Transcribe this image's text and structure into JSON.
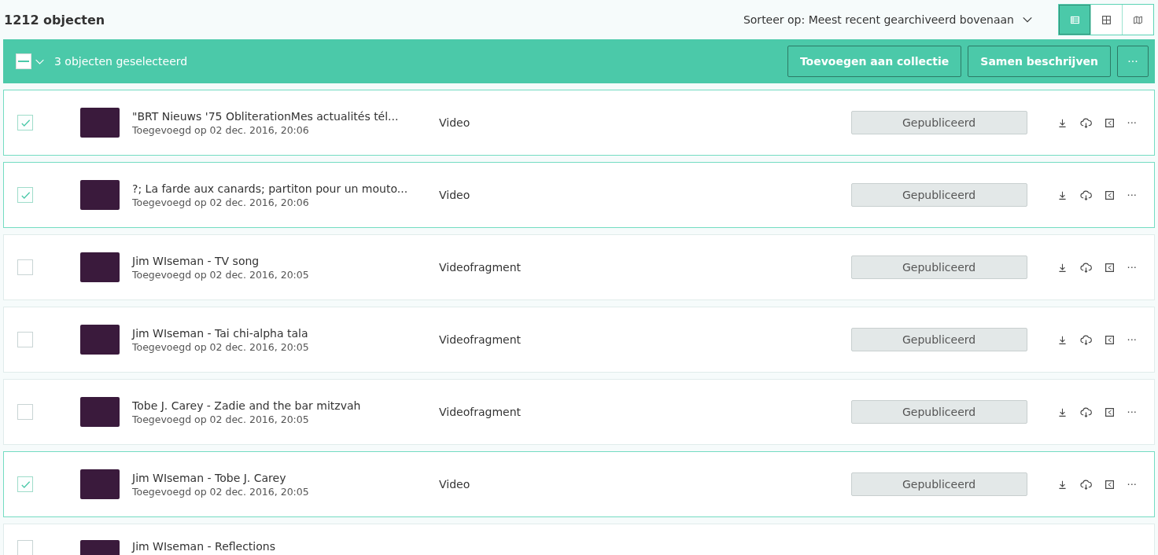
{
  "header": {
    "count": "1212 objecten",
    "sort": "Sorteer op: Meest recent gearchiveerd bovenaan",
    "views": [
      {
        "kind": "list",
        "selected": true
      },
      {
        "kind": "grid",
        "selected": false
      },
      {
        "kind": "map",
        "selected": false
      }
    ]
  },
  "selection_bar": {
    "indeterminate": true,
    "label": "3 objecten geselecteerd",
    "buttons": [
      "Toevoegen aan collectie",
      "Samen beschrijven"
    ],
    "more": "···"
  },
  "rows": [
    {
      "selected": true,
      "title": "\"BRT Nieuws '75 ObliterationMes actualités tél...",
      "date": "Toegevoegd op 02 dec. 2016, 20:06",
      "type": "Video",
      "status": "Gepubliceerd",
      "more": "···"
    },
    {
      "selected": true,
      "title": "?; La farde aux canards; partiton pour un mouto...",
      "date": "Toegevoegd op 02 dec. 2016, 20:06",
      "type": "Video",
      "status": "Gepubliceerd",
      "more": "···"
    },
    {
      "selected": false,
      "title": "Jim WIseman - TV song",
      "date": "Toegevoegd op 02 dec. 2016, 20:05",
      "type": "Videofragment",
      "status": "Gepubliceerd",
      "more": "···"
    },
    {
      "selected": false,
      "title": "Jim WIseman - Tai chi-alpha tala",
      "date": "Toegevoegd op 02 dec. 2016, 20:05",
      "type": "Videofragment",
      "status": "Gepubliceerd",
      "more": "···"
    },
    {
      "selected": false,
      "title": "Tobe J. Carey - Zadie and the bar mitzvah",
      "date": "Toegevoegd op 02 dec. 2016, 20:05",
      "type": "Videofragment",
      "status": "Gepubliceerd",
      "more": "···"
    },
    {
      "selected": true,
      "title": "Jim WIseman - Tobe J. Carey",
      "date": "Toegevoegd op 02 dec. 2016, 20:05",
      "type": "Video",
      "status": "Gepubliceerd",
      "more": "···"
    },
    {
      "selected": false,
      "title": "Jim WIseman - Reflections"
    }
  ]
}
